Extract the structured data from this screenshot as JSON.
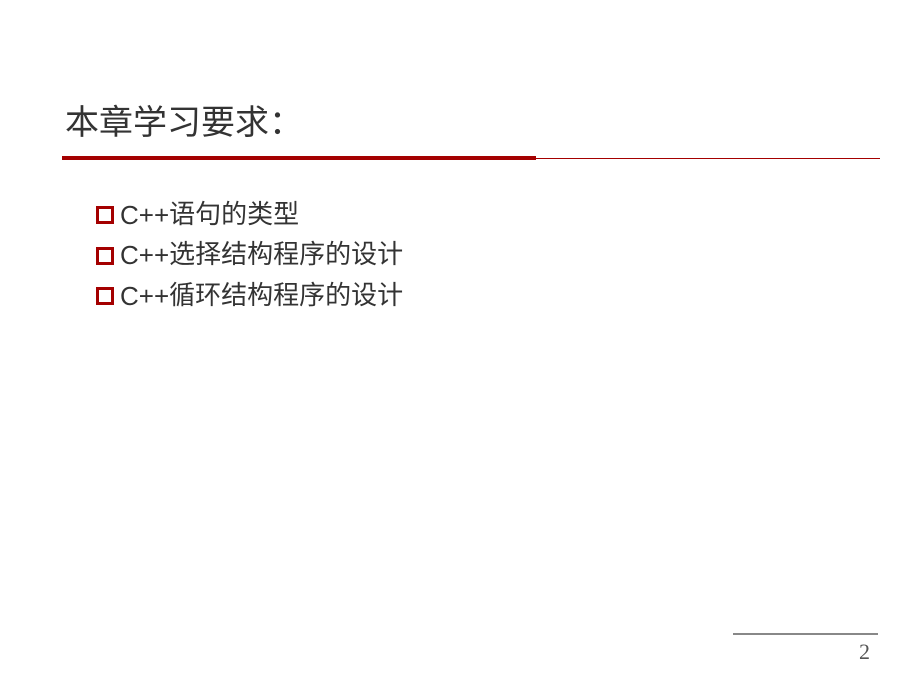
{
  "title": "本章学习要求：",
  "bullets": [
    {
      "latin": "C++",
      "cjk": "语句的类型"
    },
    {
      "latin": "C++",
      "cjk": "选择结构程序的设计"
    },
    {
      "latin": "C++",
      "cjk": "循环结构程序的设计"
    }
  ],
  "pageNumber": "2"
}
